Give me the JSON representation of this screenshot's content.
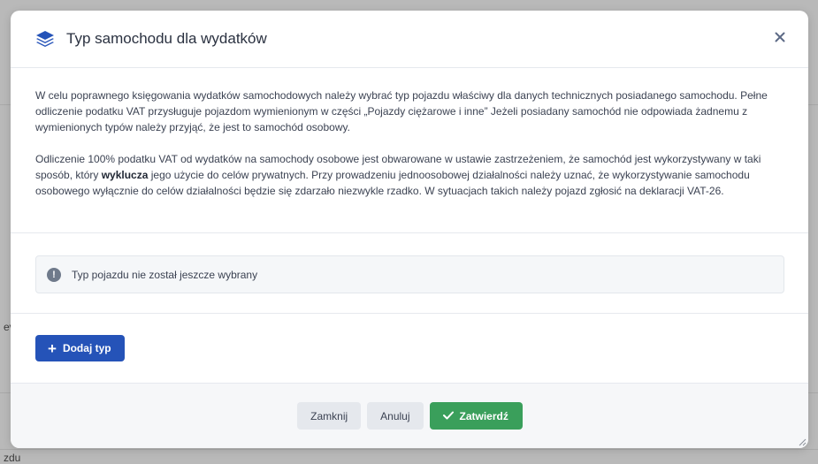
{
  "background": {
    "left_fragment": "ev",
    "bottom_fragment": "zdu"
  },
  "modal": {
    "title": "Typ samochodu dla wydatków",
    "header_icon": "layers-icon",
    "close_icon": "close-icon",
    "paragraph1": "W celu poprawnego księgowania wydatków samochodowych należy wybrać typ pojazdu właściwy dla danych technicznych posiadanego samochodu. Pełne odliczenie podatku VAT przysługuje pojazdom wymienionym w części „Pojazdy ciężarowe i inne” Jeżeli posiadany samochód nie odpowiada żadnemu z wymienionych typów należy przyjąć, że jest to samochód osobowy.",
    "paragraph2": {
      "before": "Odliczenie 100% podatku VAT od wydatków na samochody osobowe jest obwarowane w ustawie zastrzeżeniem, że samochód jest wykorzystywany w taki sposób, który ",
      "bold": "wyklucza",
      "after": " jego użycie do celów prywatnych. Przy prowadzeniu jednoosobowej działalności należy uznać, że wykorzystywanie samochodu osobowego wyłącznie do celów działalności będzie się zdarzało niezwykle rzadko. W sytuacjach takich należy pojazd zgłosić na deklaracji VAT-26."
    },
    "alert": {
      "icon": "exclamation-circle-icon",
      "text": "Typ pojazdu nie został jeszcze wybrany"
    },
    "add_button": {
      "icon": "plus-icon",
      "label": "Dodaj typ"
    },
    "footer": {
      "close_label": "Zamknij",
      "cancel_label": "Anuluj",
      "confirm_icon": "check-icon",
      "confirm_label": "Zatwierdź"
    }
  },
  "colors": {
    "primary": "#2553b8",
    "success": "#3a9f5b",
    "overlay": "#b9b9b9"
  }
}
